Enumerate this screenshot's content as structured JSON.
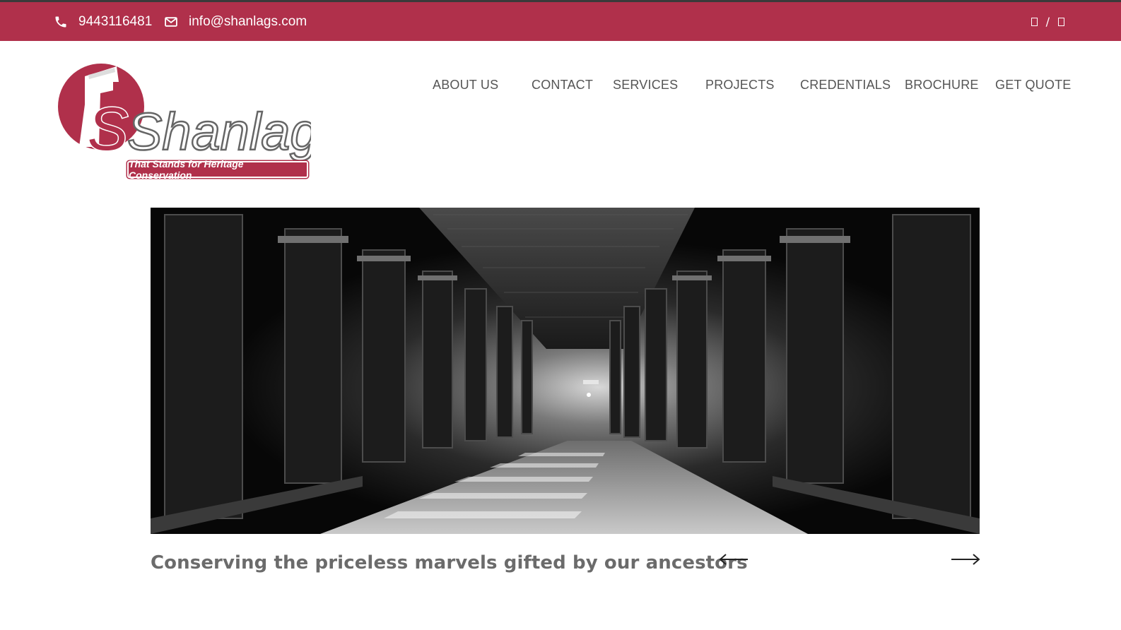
{
  "topbar": {
    "phone": "9443116481",
    "email": "info@shanlags.com",
    "social_separator": "/",
    "icons": [
      "phone-icon",
      "envelope-icon",
      "social-icon-1",
      "social-icon-2"
    ]
  },
  "logo": {
    "text": "Shanlags",
    "tagline": "That Stands for Heritage Conservation"
  },
  "nav": {
    "items": [
      {
        "label": "ABOUT US"
      },
      {
        "label": "CONTACT"
      },
      {
        "label": "SERVICES"
      },
      {
        "label": "PROJECTS"
      },
      {
        "label": "CREDENTIALS"
      },
      {
        "label": "BROCHURE"
      },
      {
        "label": "GET QUOTE"
      }
    ]
  },
  "slider": {
    "caption": "Conserving the priceless marvels gifted by our ancestors",
    "prev_icon": "arrow-left-icon",
    "next_icon": "arrow-right-icon"
  },
  "colors": {
    "brand": "#b0304b",
    "nav_text": "#555555",
    "caption_text": "#6b6b6b"
  }
}
